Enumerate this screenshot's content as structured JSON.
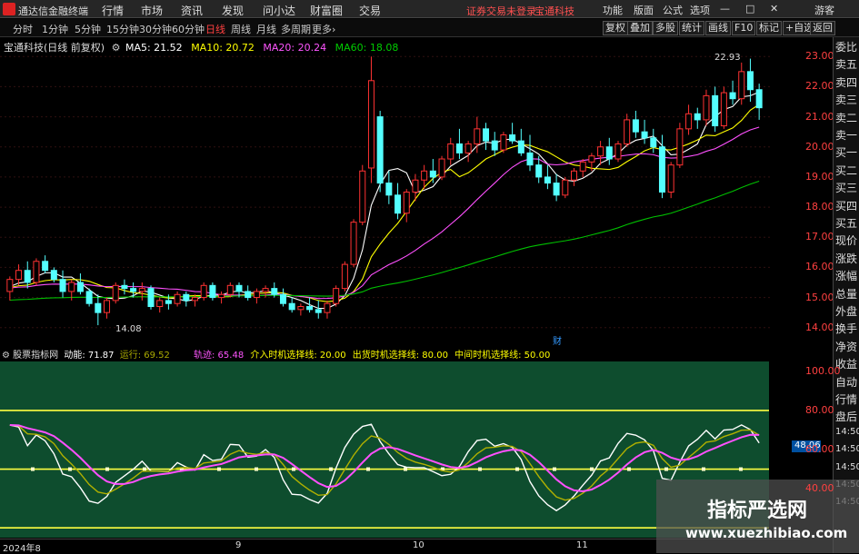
{
  "window": {
    "app_title": "通达信金融终端",
    "notice": "证券交易未登录",
    "stock_link": "宝通科技",
    "guest": "游客",
    "btn_min": "—",
    "btn_max": "□",
    "btn_close": "✕"
  },
  "menu": {
    "items": [
      "行情",
      "市场",
      "资讯",
      "发现",
      "问小达",
      "财富圈",
      "交易"
    ],
    "right": [
      "功能",
      "版面",
      "公式",
      "选项"
    ]
  },
  "tabs": {
    "periods": [
      "分时",
      "1分钟",
      "5分钟",
      "15分钟",
      "30分钟",
      "60分钟",
      "日线",
      "周线",
      "月线",
      "多周期",
      "更多›"
    ],
    "active": "日线",
    "right_buttons": [
      "复权",
      "叠加",
      "多股",
      "统计",
      "画线",
      "F10",
      "标记",
      "+自选",
      "返回"
    ]
  },
  "chart": {
    "header": {
      "stock": "宝通科技(日线 前复权)",
      "ma5": "MA5: 21.52",
      "ma10": "MA10: 20.72",
      "ma20": "MA20: 20.24",
      "ma60": "MA60: 18.08"
    },
    "high_label": "22.93",
    "low_label": "14.08",
    "fin_marker": "财",
    "y_ticks": [
      "23.00",
      "22.00",
      "21.00",
      "20.00",
      "19.00",
      "18.00",
      "17.00",
      "16.00",
      "15.00",
      "14.00"
    ],
    "colors": {
      "up": "#ff3232",
      "down": "#54ffff",
      "ma5": "#ffffff",
      "ma10": "#ffff00",
      "ma20": "#ff50ff",
      "ma60": "#00c000"
    }
  },
  "indicator": {
    "name": "股票指标网",
    "dongneng": "动能: 71.87",
    "yunxing": "运行: 69.52",
    "guiji": "轨迹: 65.48",
    "jieru": "介入时机选择线: 20.00",
    "chuxiao": "出货时机选择线: 80.00",
    "zhongjian": "中间时机选择线: 50.00",
    "y_ticks": [
      "100.00",
      "80.00",
      "60.00",
      "40.00"
    ],
    "value_tag": "48.06",
    "bg": "#0e4d2e"
  },
  "dates": [
    "2024年8",
    "9",
    "10",
    "11"
  ],
  "side_panel": {
    "items": [
      "委比",
      "卖五",
      "卖四",
      "卖三",
      "卖二",
      "卖一",
      "买一",
      "买二",
      "买三",
      "买四",
      "买五",
      "现价",
      "涨跌",
      "涨幅",
      "总量",
      "外盘",
      "换手",
      "净资",
      "收益",
      "自动",
      "行情",
      "盘后",
      "14:50",
      "14:50",
      "14:50",
      "14:50",
      "14:50"
    ]
  },
  "watermark": {
    "title": "指标严选网",
    "url": "www.xuezhibiao.com"
  },
  "chart_data": {
    "type": "candlestick",
    "title": "宝通科技(日线 前复权)",
    "ylim": [
      13.6,
      23.4
    ],
    "candles": [
      [
        15.2,
        15.7,
        14.9,
        15.6
      ],
      [
        15.6,
        16.1,
        15.4,
        15.9
      ],
      [
        15.9,
        16.2,
        15.3,
        15.5
      ],
      [
        15.5,
        16.3,
        15.4,
        16.2
      ],
      [
        16.2,
        16.4,
        15.8,
        15.9
      ],
      [
        15.9,
        16.0,
        15.5,
        15.6
      ],
      [
        15.6,
        15.9,
        15.0,
        15.2
      ],
      [
        15.2,
        15.6,
        14.9,
        15.5
      ],
      [
        15.5,
        15.8,
        15.1,
        15.2
      ],
      [
        15.2,
        15.3,
        14.7,
        14.8
      ],
      [
        14.8,
        15.1,
        14.08,
        14.5
      ],
      [
        14.5,
        15.0,
        14.3,
        14.9
      ],
      [
        14.9,
        15.5,
        14.8,
        15.4
      ],
      [
        15.4,
        15.6,
        15.1,
        15.3
      ],
      [
        15.3,
        15.5,
        15.0,
        15.2
      ],
      [
        15.2,
        15.5,
        14.9,
        15.3
      ],
      [
        15.3,
        15.4,
        14.6,
        14.7
      ],
      [
        14.7,
        15.0,
        14.5,
        14.9
      ],
      [
        14.9,
        15.1,
        14.6,
        14.8
      ],
      [
        14.8,
        15.2,
        14.7,
        15.1
      ],
      [
        15.1,
        15.2,
        14.7,
        14.9
      ],
      [
        14.9,
        15.1,
        14.7,
        15.0
      ],
      [
        15.0,
        15.5,
        14.9,
        15.4
      ],
      [
        15.4,
        15.5,
        14.9,
        15.0
      ],
      [
        15.0,
        15.2,
        14.8,
        15.1
      ],
      [
        15.1,
        15.5,
        15.0,
        15.4
      ],
      [
        15.4,
        15.5,
        15.0,
        15.2
      ],
      [
        15.2,
        15.4,
        14.9,
        15.0
      ],
      [
        15.0,
        15.3,
        14.8,
        15.2
      ],
      [
        15.2,
        15.4,
        15.0,
        15.3
      ],
      [
        15.3,
        15.5,
        15.0,
        15.1
      ],
      [
        15.1,
        15.3,
        14.7,
        14.8
      ],
      [
        14.8,
        15.0,
        14.5,
        14.6
      ],
      [
        14.6,
        14.8,
        14.4,
        14.7
      ],
      [
        14.7,
        15.0,
        14.5,
        14.6
      ],
      [
        14.6,
        14.9,
        14.3,
        14.5
      ],
      [
        14.5,
        14.9,
        14.3,
        14.8
      ],
      [
        14.8,
        15.4,
        14.7,
        15.3
      ],
      [
        15.3,
        16.2,
        15.2,
        16.1
      ],
      [
        16.1,
        17.6,
        16.0,
        17.5
      ],
      [
        17.5,
        19.4,
        17.4,
        19.2
      ],
      [
        19.3,
        23.0,
        18.8,
        22.2
      ],
      [
        21.0,
        21.2,
        18.5,
        18.8
      ],
      [
        18.8,
        19.2,
        18.1,
        18.4
      ],
      [
        18.4,
        18.8,
        17.6,
        17.8
      ],
      [
        17.8,
        18.6,
        17.5,
        18.5
      ],
      [
        18.5,
        19.1,
        18.2,
        18.9
      ],
      [
        18.9,
        19.4,
        18.6,
        19.2
      ],
      [
        19.2,
        19.6,
        18.8,
        19.0
      ],
      [
        19.0,
        19.7,
        18.9,
        19.6
      ],
      [
        19.6,
        20.3,
        19.4,
        20.1
      ],
      [
        20.1,
        20.6,
        19.6,
        19.8
      ],
      [
        19.8,
        20.2,
        19.5,
        20.1
      ],
      [
        20.1,
        21.0,
        19.8,
        20.6
      ],
      [
        20.6,
        20.8,
        19.9,
        20.2
      ],
      [
        20.2,
        20.5,
        19.7,
        19.9
      ],
      [
        19.9,
        20.5,
        19.8,
        20.4
      ],
      [
        20.4,
        20.8,
        20.1,
        20.2
      ],
      [
        20.2,
        20.6,
        19.7,
        19.8
      ],
      [
        19.8,
        20.4,
        19.2,
        19.4
      ],
      [
        19.4,
        19.7,
        18.8,
        19.0
      ],
      [
        19.0,
        19.4,
        18.6,
        18.8
      ],
      [
        18.8,
        19.1,
        18.2,
        18.4
      ],
      [
        18.4,
        19.0,
        18.3,
        18.9
      ],
      [
        18.9,
        19.3,
        18.7,
        19.2
      ],
      [
        19.2,
        19.6,
        19.0,
        19.5
      ],
      [
        19.5,
        19.8,
        19.2,
        19.7
      ],
      [
        19.7,
        20.2,
        19.4,
        20.0
      ],
      [
        20.0,
        20.3,
        19.4,
        19.6
      ],
      [
        19.6,
        20.2,
        19.5,
        20.1
      ],
      [
        20.1,
        21.1,
        20.0,
        20.9
      ],
      [
        20.9,
        21.2,
        20.3,
        20.5
      ],
      [
        20.5,
        20.9,
        20.1,
        20.3
      ],
      [
        20.3,
        20.6,
        19.8,
        20.0
      ],
      [
        20.0,
        20.4,
        18.3,
        18.5
      ],
      [
        18.5,
        19.5,
        18.3,
        19.4
      ],
      [
        19.4,
        20.8,
        19.3,
        20.6
      ],
      [
        20.6,
        21.4,
        20.4,
        21.1
      ],
      [
        21.1,
        21.3,
        20.6,
        20.9
      ],
      [
        20.9,
        21.9,
        20.7,
        21.7
      ],
      [
        21.7,
        22.0,
        20.5,
        20.7
      ],
      [
        20.7,
        22.0,
        20.6,
        21.8
      ],
      [
        21.8,
        22.2,
        21.4,
        21.6
      ],
      [
        21.6,
        22.8,
        21.4,
        22.5
      ],
      [
        22.5,
        22.93,
        21.5,
        21.9
      ],
      [
        21.9,
        22.1,
        20.9,
        21.3
      ]
    ],
    "ma_last": {
      "ma5": 21.52,
      "ma10": 20.72,
      "ma20": 20.24,
      "ma60": 18.08
    }
  }
}
